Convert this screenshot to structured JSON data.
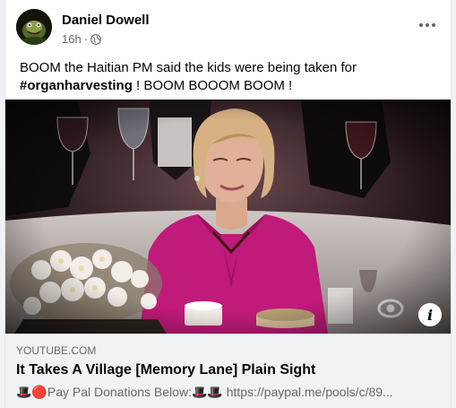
{
  "post": {
    "author": "Daniel Dowell",
    "timestamp": "16h",
    "separator": "·",
    "more_label": "•••",
    "text_before": "BOOM  the Haitian PM said the kids were being taken for ",
    "hashtag": "#organharvesting",
    "text_after": " !  BOOM BOOOM BOOM !"
  },
  "link_preview": {
    "domain": "YOUTUBE.COM",
    "title": "It Takes A Village [Memory Lane] Plain Sight",
    "description": "🎩🔴Pay Pal Donations Below:🎩🎩 https://paypal.me/pools/c/89...",
    "info_label": "i"
  },
  "colors": {
    "secondary_text": "#65676b",
    "preview_bg": "#f0f2f5",
    "jacket": "#c01a7a"
  },
  "icons": {
    "privacy": "globe-icon",
    "menu": "more-horizontal-icon",
    "info": "info-icon"
  }
}
